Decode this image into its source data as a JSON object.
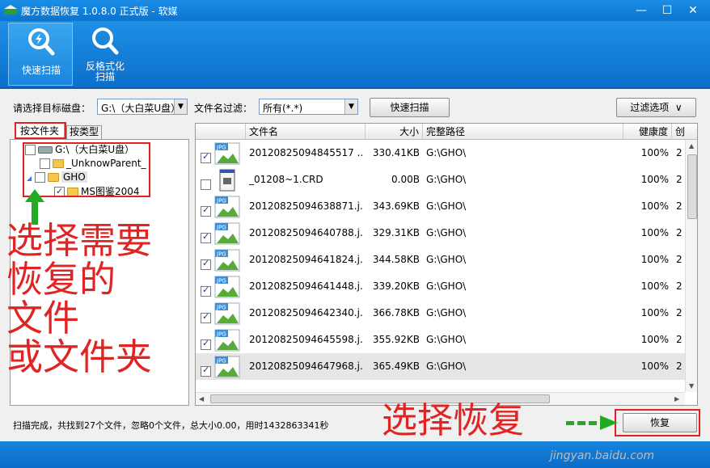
{
  "window": {
    "title": "魔方数据恢复 1.0.8.0 正式版 - 软媒",
    "minimize": "—",
    "maximize": "☐",
    "close": "✕"
  },
  "toolbar": {
    "quick_scan": "快速扫描",
    "format_scan_line1": "反格式化",
    "format_scan_line2": "扫描"
  },
  "filters": {
    "disk_label": "请选择目标磁盘：",
    "disk_value": "G:\\（大白菜U盘）",
    "filename_label": "文件名过滤：",
    "filename_value": "所有(*.*)",
    "quick_scan_button": "快速扫描",
    "filter_options_button": "过滤选项"
  },
  "tabs": {
    "by_folder": "按文件夹",
    "by_type": "按类型"
  },
  "tree": {
    "root": "G:\\（大白菜U盘）",
    "child1": "_UnknowParent_",
    "child2": "GHO",
    "child2_1": "MS图鉴2004"
  },
  "columns": {
    "name": "文件名",
    "size": "大小",
    "path": "完整路径",
    "health": "健康度",
    "extra": "创"
  },
  "files": [
    {
      "name": "20120825094845517 ...",
      "size": "330.41KB",
      "path": "G:\\GHO\\",
      "health": "100%",
      "extra": "2",
      "checked": true,
      "icon": "JPG"
    },
    {
      "name": "_01208~1.CRD",
      "size": "0.00B",
      "path": "G:\\GHO\\",
      "health": "100%",
      "extra": "2",
      "checked": false,
      "icon": "CRD"
    },
    {
      "name": "20120825094638871.j...",
      "size": "343.69KB",
      "path": "G:\\GHO\\",
      "health": "100%",
      "extra": "2",
      "checked": true,
      "icon": "JPG"
    },
    {
      "name": "20120825094640788.j...",
      "size": "329.31KB",
      "path": "G:\\GHO\\",
      "health": "100%",
      "extra": "2",
      "checked": true,
      "icon": "JPG"
    },
    {
      "name": "20120825094641824.j...",
      "size": "344.58KB",
      "path": "G:\\GHO\\",
      "health": "100%",
      "extra": "2",
      "checked": true,
      "icon": "JPG"
    },
    {
      "name": "20120825094641448.j...",
      "size": "339.20KB",
      "path": "G:\\GHO\\",
      "health": "100%",
      "extra": "2",
      "checked": true,
      "icon": "JPG"
    },
    {
      "name": "20120825094642340.j...",
      "size": "366.78KB",
      "path": "G:\\GHO\\",
      "health": "100%",
      "extra": "2",
      "checked": true,
      "icon": "JPG"
    },
    {
      "name": "20120825094645598.j...",
      "size": "355.92KB",
      "path": "G:\\GHO\\",
      "health": "100%",
      "extra": "2",
      "checked": true,
      "icon": "JPG"
    },
    {
      "name": "20120825094647968.j...",
      "size": "365.49KB",
      "path": "G:\\GHO\\",
      "health": "100%",
      "extra": "2",
      "checked": true,
      "icon": "JPG"
    }
  ],
  "status": "扫描完成，共找到27个文件，忽略0个文件，总大小0.00，用时1432863341秒",
  "recover_button": "恢复",
  "annotations": {
    "left_line1": "选择需要",
    "left_line2": "恢复的",
    "left_line3": "文件",
    "left_line4": "或文件夹",
    "bottom": "选择恢复"
  },
  "watermark": "jingyan.baidu.com",
  "colors": {
    "accent_blue": "#0b6fc4",
    "annotation_red": "#e52020",
    "arrow_green": "#22aa22"
  }
}
